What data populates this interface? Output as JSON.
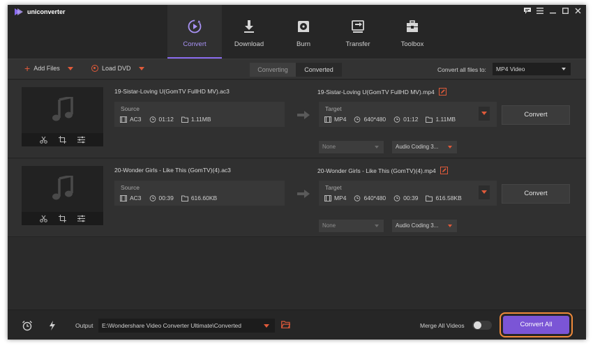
{
  "app": {
    "name": "uniconverter"
  },
  "nav": {
    "tabs": [
      {
        "label": "Convert",
        "icon": "convert-icon",
        "active": true
      },
      {
        "label": "Download",
        "icon": "download-icon"
      },
      {
        "label": "Burn",
        "icon": "burn-icon"
      },
      {
        "label": "Transfer",
        "icon": "transfer-icon"
      },
      {
        "label": "Toolbox",
        "icon": "toolbox-icon"
      }
    ]
  },
  "toolbar": {
    "add_files": "Add Files",
    "load_dvd": "Load DVD",
    "segment_converting": "Converting",
    "segment_converted": "Converted",
    "convert_all_to_label": "Convert all files to:",
    "format_value": "MP4 Video"
  },
  "files": [
    {
      "source_name": "19-Sistar-Loving U(GomTV FullHD MV).ac3",
      "source_label": "Source",
      "source_format": "AC3",
      "source_duration": "01:12",
      "source_size": "1.11MB",
      "target_name": "19-Sistar-Loving U(GomTV FullHD MV).mp4",
      "target_label": "Target",
      "target_format": "MP4",
      "target_resolution": "640*480",
      "target_duration": "01:12",
      "target_size": "1.11MB",
      "convert_label": "Convert",
      "subtitle_value": "None",
      "audio_value": "Audio Coding 3..."
    },
    {
      "source_name": "20-Wonder Girls - Like This (GomTV)(4).ac3",
      "source_label": "Source",
      "source_format": "AC3",
      "source_duration": "00:39",
      "source_size": "616.60KB",
      "target_name": "20-Wonder Girls - Like This (GomTV)(4).mp4",
      "target_label": "Target",
      "target_format": "MP4",
      "target_resolution": "640*480",
      "target_duration": "00:39",
      "target_size": "616.58KB",
      "convert_label": "Convert",
      "subtitle_value": "None",
      "audio_value": "Audio Coding 3..."
    }
  ],
  "bottom": {
    "output_label": "Output",
    "output_path": "E:\\Wondershare Video Converter Ultimate\\Converted",
    "merge_label": "Merge All Videos",
    "merge_enabled": false,
    "convert_all_label": "Convert All"
  },
  "colors": {
    "accent": "#8a6cf0",
    "brand_orange": "#e05a3a",
    "convert_all_bg": "#7b55d6",
    "highlight_ring": "#f08a3a"
  }
}
